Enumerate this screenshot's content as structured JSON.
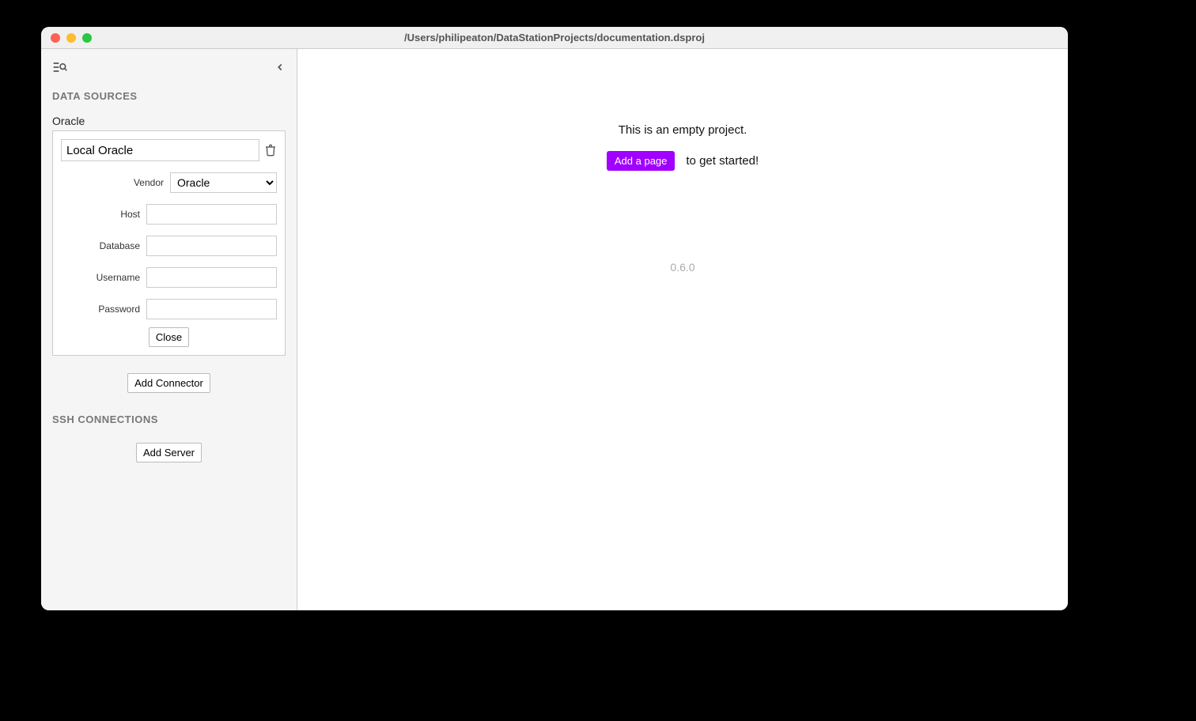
{
  "window": {
    "title": "/Users/philipeaton/DataStationProjects/documentation.dsproj"
  },
  "sidebar": {
    "sections": {
      "data_sources": {
        "header": "DATA SOURCES",
        "vendor_label_outer": "Oracle",
        "connector": {
          "name": "Local Oracle",
          "fields": {
            "vendor_label": "Vendor",
            "vendor_value": "Oracle",
            "host_label": "Host",
            "host_value": "",
            "database_label": "Database",
            "database_value": "",
            "username_label": "Username",
            "username_value": "",
            "password_label": "Password",
            "password_value": ""
          },
          "close_label": "Close"
        },
        "add_connector_label": "Add Connector"
      },
      "ssh": {
        "header": "SSH CONNECTIONS",
        "add_server_label": "Add Server"
      }
    }
  },
  "main": {
    "empty_message": "This is an empty project.",
    "add_page_label": "Add a page",
    "get_started_text": "to get started!",
    "version": "0.6.0"
  }
}
